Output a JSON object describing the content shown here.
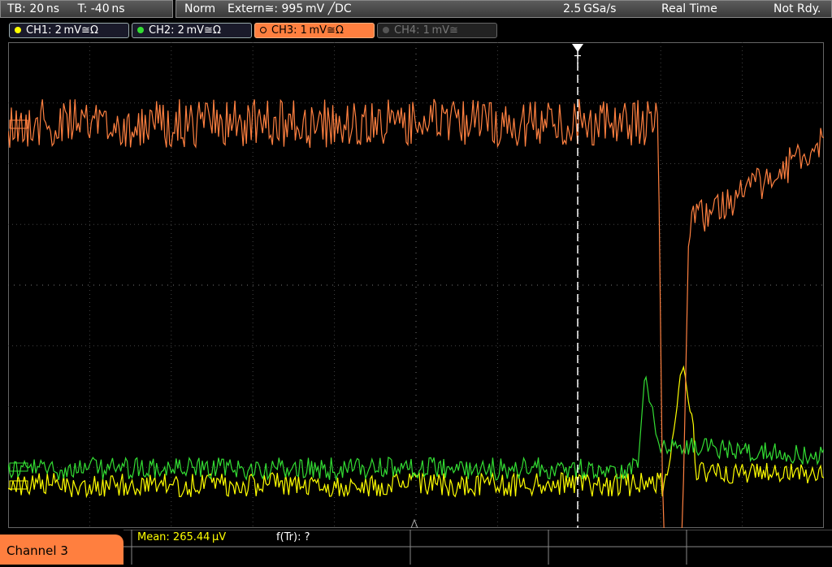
{
  "topbar": {
    "timebase": "TB: 20 ns",
    "trigger_time": "T: -40 ns",
    "mode": "Norm",
    "trigger_source": "Extern≅: 995 mV ╱DC",
    "sample_rate": "2.5 GSa/s",
    "acq_mode": "Real Time",
    "status": "Not Rdy."
  },
  "channels": [
    {
      "label": "CH1: 2 mV≅Ω",
      "color": "#ffff00"
    },
    {
      "label": "CH2: 2 mV≅Ω",
      "color": "#33dd33"
    },
    {
      "label": "CH3: 1 mV≅Ω",
      "color": "#ff7f3f"
    },
    {
      "label": "CH4: 1 mV≅",
      "color": "#777777"
    }
  ],
  "trigger_marker": "T",
  "footer": {
    "active_channel": "Channel 3",
    "mean": "Mean: 265.44 μV",
    "ftr": "f(Tr): ?"
  }
}
